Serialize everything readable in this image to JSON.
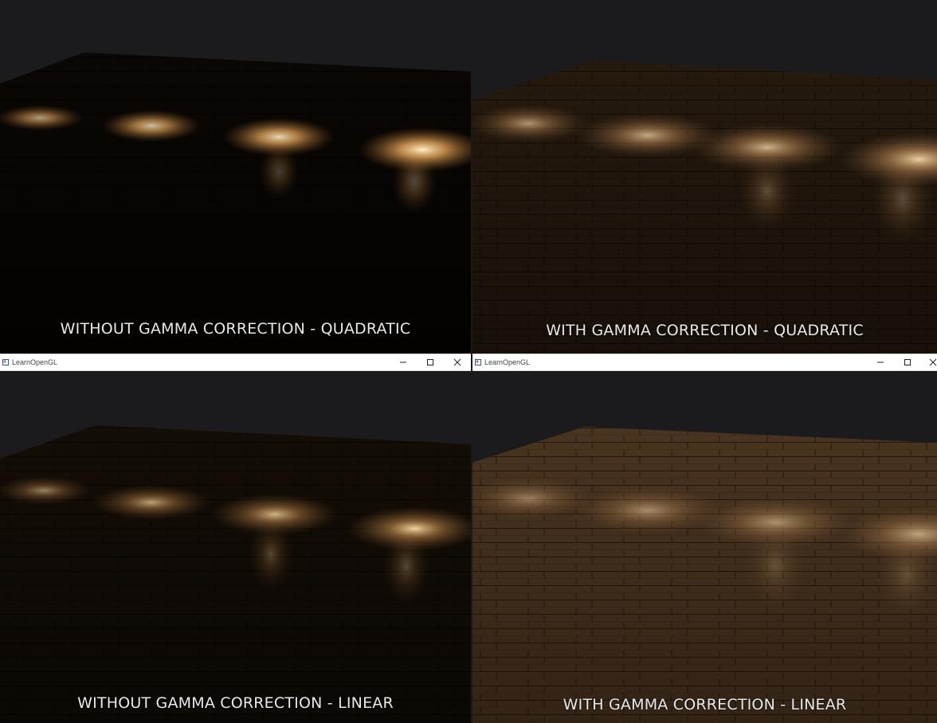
{
  "windows": [
    {
      "title": "LearnOpenGL"
    },
    {
      "title": "LearnOpenGL"
    }
  ],
  "panels": [
    {
      "caption": "WITHOUT GAMMA CORRECTION - QUADRATIC"
    },
    {
      "caption": "WITH GAMMA CORRECTION - QUADRATIC"
    },
    {
      "caption": "WITHOUT GAMMA CORRECTION - LINEAR"
    },
    {
      "caption": "WITH GAMMA CORRECTION - LINEAR"
    }
  ],
  "icons": {
    "app": "app-window-icon",
    "minimize": "minimize-icon",
    "maximize": "maximize-icon",
    "close": "close-icon"
  },
  "colors": {
    "background": "#1b1b1d",
    "light": "#ffd58a",
    "wood": "#6b4a2a",
    "caption": "#e9e9e9"
  }
}
